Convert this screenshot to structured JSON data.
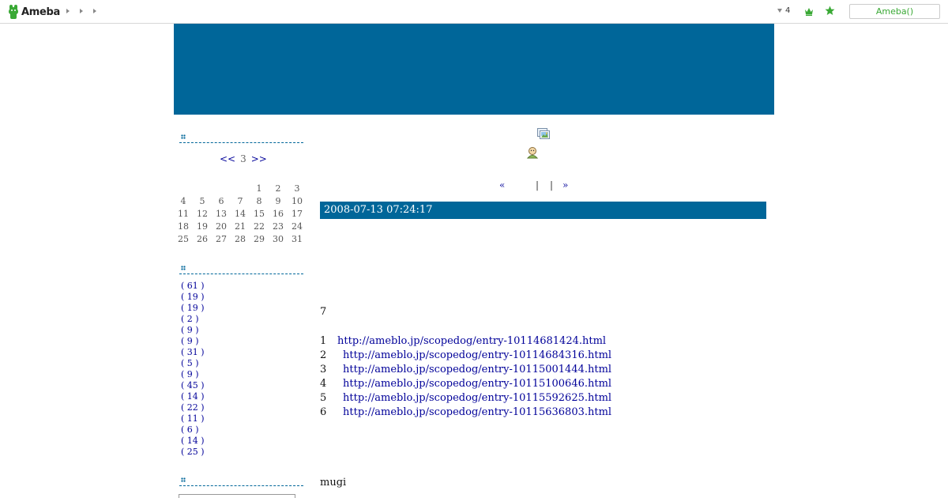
{
  "topbar": {
    "logo_text": "Ameba",
    "nav_arrow_count": 3,
    "notification_count": "4",
    "ameba_button": "Ameba()",
    "brand_color": "#3aa935"
  },
  "header": {
    "color": "#006699"
  },
  "sidebar": {
    "calendar": {
      "prev": "<<",
      "month": "3",
      "next": ">>",
      "weeks": [
        [
          "",
          "",
          "",
          "",
          "1",
          "2",
          "3"
        ],
        [
          "4",
          "5",
          "6",
          "7",
          "8",
          "9",
          "10"
        ],
        [
          "11",
          "12",
          "13",
          "14",
          "15",
          "16",
          "17"
        ],
        [
          "18",
          "19",
          "20",
          "21",
          "22",
          "23",
          "24"
        ],
        [
          "25",
          "26",
          "27",
          "28",
          "29",
          "30",
          "31"
        ]
      ]
    },
    "categories": [
      "( 61 )",
      "( 19 )",
      "( 19 )",
      "( 2 )",
      "( 9 )",
      "( 9 )",
      "( 31 )",
      "( 5 )",
      "( 9 )",
      "( 45 )",
      "( 14 )",
      "( 22 )",
      "( 11 )",
      "( 6 )",
      "( 14 )",
      "( 25 )"
    ]
  },
  "main": {
    "pager": {
      "prev": "«",
      "sep1": "|",
      "sep2": "|",
      "next": "»"
    },
    "entry_date": "2008-07-13 07:24:17",
    "line_seven": "7",
    "links": [
      {
        "num": "1",
        "url": "http://ameblo.jp/scopedog/entry-10114681424.html"
      },
      {
        "num": "2",
        "url": "http://ameblo.jp/scopedog/entry-10114684316.html"
      },
      {
        "num": "3",
        "url": "http://ameblo.jp/scopedog/entry-10115001444.html"
      },
      {
        "num": "4",
        "url": "http://ameblo.jp/scopedog/entry-10115100646.html"
      },
      {
        "num": "5",
        "url": "http://ameblo.jp/scopedog/entry-10115592625.html"
      },
      {
        "num": "6",
        "url": "http://ameblo.jp/scopedog/entry-10115636803.html"
      }
    ],
    "author": "mugi"
  }
}
